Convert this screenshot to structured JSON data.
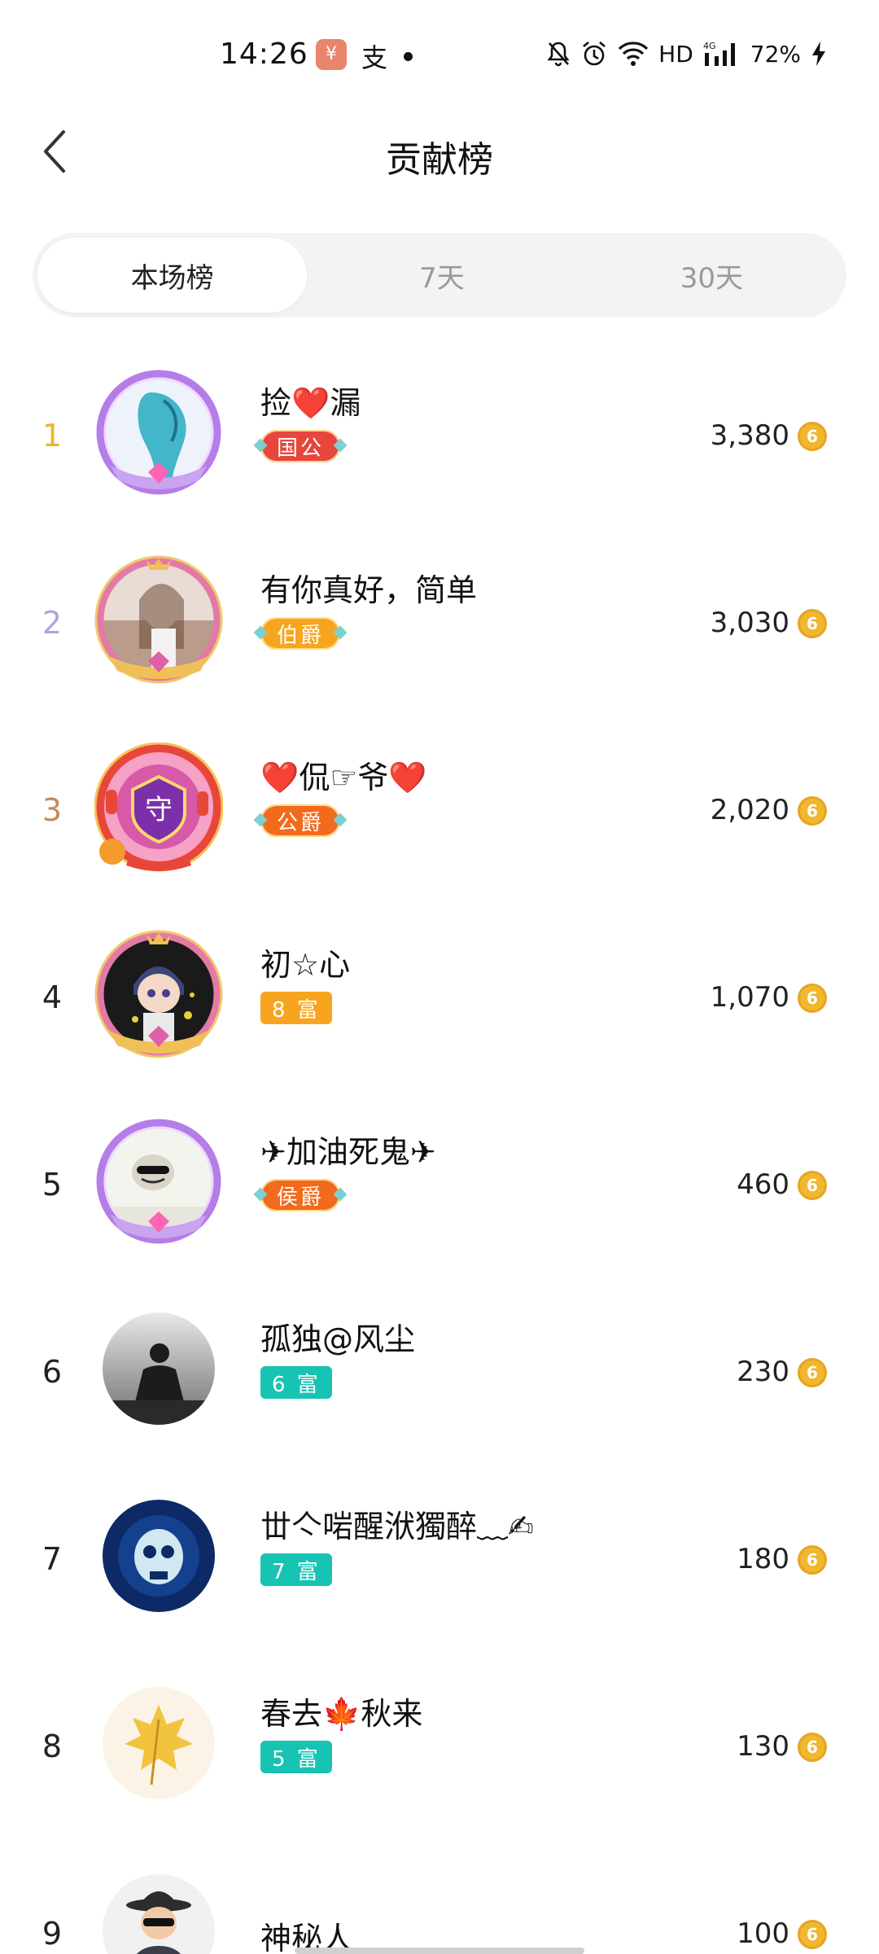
{
  "status_bar": {
    "time": "14:26",
    "app_icon_1": "¥",
    "app_icon_2": "支",
    "network": "HD",
    "signal_label": "4G",
    "battery": "72%"
  },
  "header": {
    "title": "贡献榜",
    "back_icon": "chevron-left-icon"
  },
  "tabs": [
    {
      "label": "本场榜",
      "active": true
    },
    {
      "label": "7天",
      "active": false
    },
    {
      "label": "30天",
      "active": false
    }
  ],
  "rankings": [
    {
      "rank": "1",
      "name": "捡❤️漏",
      "badge": "国公",
      "score": "3,380"
    },
    {
      "rank": "2",
      "name": "有你真好，简单",
      "badge": "伯爵",
      "score": "3,030"
    },
    {
      "rank": "3",
      "name": "❤️侃☞爷❤️",
      "badge": "公爵",
      "score": "2,020"
    },
    {
      "rank": "4",
      "name": "初☆心",
      "badge": "8 富",
      "score": "1,070"
    },
    {
      "rank": "5",
      "name": "✈加油死鬼✈",
      "badge": "侯爵",
      "score": "460"
    },
    {
      "rank": "6",
      "name": "孤独@风尘",
      "badge": "6 富",
      "score": "230"
    },
    {
      "rank": "7",
      "name": "丗亽啱醒洑獨醉﹏✍",
      "badge": "7 富",
      "score": "180"
    },
    {
      "rank": "8",
      "name": "春去🍁秋来",
      "badge": "5 富",
      "score": "130"
    },
    {
      "rank": "9",
      "name": "神秘人",
      "badge": "",
      "score": "100"
    }
  ],
  "coin_icon_symbol": "6",
  "colors": {
    "gold": "#f0b428",
    "silver": "#a8a6e0",
    "bronze": "#c68a52",
    "coin": "#f0b72f",
    "teal_badge": "#17c3b2",
    "orange_badge": "#f7a51e",
    "noble_red": "#e8453c",
    "noble_orange": "#f26a1b"
  }
}
